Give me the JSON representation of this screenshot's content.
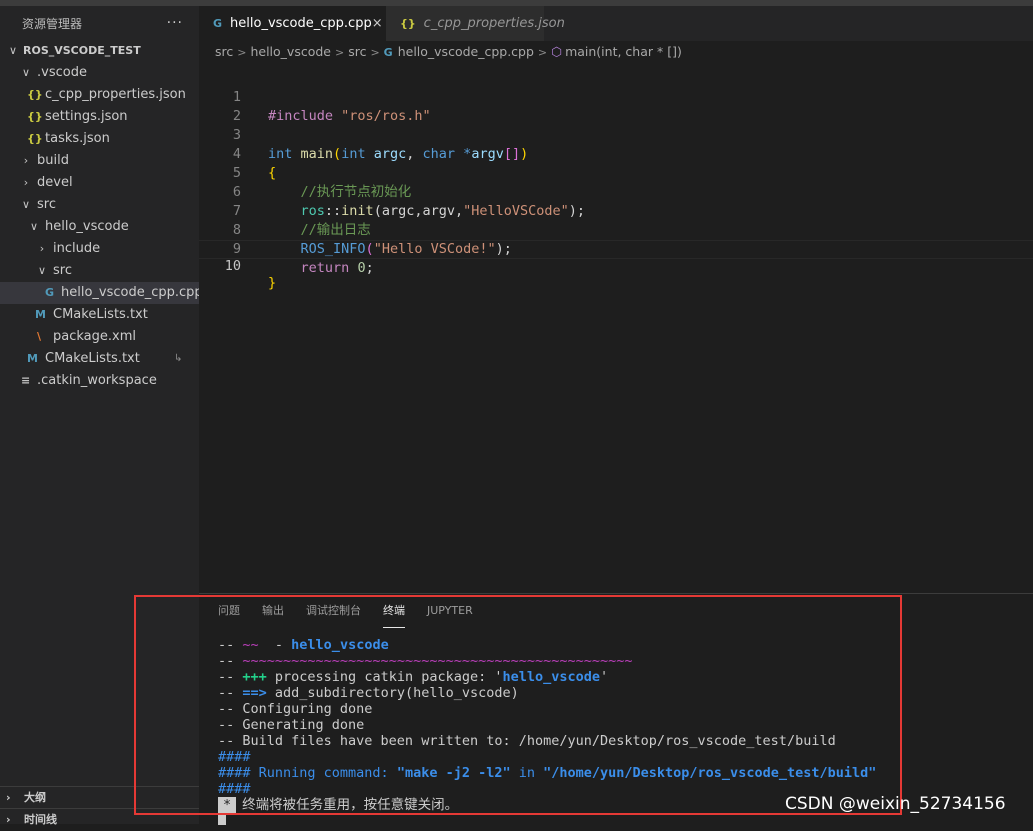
{
  "explorer": {
    "title": "资源管理器",
    "more": "···",
    "root": "ROS_VSCODE_TEST",
    "items": [
      {
        "label": ".vscode",
        "chev": "∨",
        "indent": 1
      },
      {
        "label": "c_cpp_properties.json",
        "icon": "{}",
        "indent": 2
      },
      {
        "label": "settings.json",
        "icon": "{}",
        "indent": 2
      },
      {
        "label": "tasks.json",
        "icon": "{}",
        "indent": 2
      },
      {
        "label": "build",
        "chev": "›",
        "indent": 1
      },
      {
        "label": "devel",
        "chev": "›",
        "indent": 1
      },
      {
        "label": "src",
        "chev": "∨",
        "indent": 1
      },
      {
        "label": "hello_vscode",
        "chev": "∨",
        "indent": 2
      },
      {
        "label": "include",
        "chev": "›",
        "indent": 3
      },
      {
        "label": "src",
        "chev": "∨",
        "indent": 3
      },
      {
        "label": "hello_vscode_cpp.cpp",
        "icon": "G",
        "indent": 4
      },
      {
        "label": "CMakeLists.txt",
        "icon": "M",
        "indent": 3
      },
      {
        "label": "package.xml",
        "icon": "\\",
        "indent": 3
      },
      {
        "label": "CMakeLists.txt",
        "icon": "M",
        "indent": 2,
        "badge": "↳"
      },
      {
        "label": ".catkin_workspace",
        "icon": "≡",
        "indent": 1
      }
    ],
    "outline": "大纲",
    "timeline": "时间线"
  },
  "tabs": [
    {
      "label": "hello_vscode_cpp.cpp",
      "icon": "G",
      "close": "×"
    },
    {
      "label": "c_cpp_properties.json",
      "icon": "{}"
    }
  ],
  "breadcrumbs": {
    "b1": "src",
    "b2": "hello_vscode",
    "b3": "src",
    "b4": "hello_vscode_cpp.cpp",
    "b5": "main(int, char * [])",
    "sep": ">"
  },
  "code": {
    "lines": [
      "1",
      "2",
      "3",
      "4",
      "5",
      "6",
      "7",
      "8",
      "9",
      "10"
    ],
    "l1_inc": "#include",
    "l1_str": "\"ros/ros.h\"",
    "l3_int": "int",
    "l3_main": "main",
    "l3_p1": "(",
    "l3_int2": "int",
    "l3_argc": "argc",
    "l3_comma": ",",
    "l3_char": "char",
    "l3_star": "*",
    "l3_argv": "argv",
    "l3_br": "[]",
    "l3_p2": ")",
    "l4_brace": "{",
    "l5_cm": "//执行节点初始化",
    "l6_ns": "ros",
    "l6_sc": "::",
    "l6_init": "init",
    "l6_args": "(argc,argv,",
    "l6_str": "\"HelloVSCode\"",
    "l6_end": ");",
    "l7_cm": "//输出日志",
    "l8_mac": "ROS_INFO",
    "l8_p": "(",
    "l8_str": "\"Hello VSCode!\"",
    "l8_end": ");",
    "l9_ret": "return",
    "l9_num": "0",
    "l9_end": ";",
    "l10_brace": "}"
  },
  "panel": {
    "tabs": [
      "问题",
      "输出",
      "调试控制台",
      "终端",
      "JUPYTER"
    ],
    "active_tab": "终端"
  },
  "terminal": {
    "t1_a": "-- ",
    "t1_b": "~~",
    "t1_c": "  - ",
    "t1_d": "hello_vscode",
    "t2_a": "-- ",
    "t2_b": "~~~~~~~~~~~~~~~~~~~~~~~~~~~~~~~~~~~~~~~~~~~~~~~~",
    "t3_a": "-- ",
    "t3_b": "+++",
    "t3_c": " processing catkin package: '",
    "t3_d": "hello_vscode",
    "t3_e": "'",
    "t4_a": "-- ",
    "t4_b": "==>",
    "t4_c": " add_subdirectory(hello_vscode)",
    "t5": "-- Configuring done",
    "t6": "-- Generating done",
    "t7": "-- Build files have been written to: /home/yun/Desktop/ros_vscode_test/build",
    "t8": "####",
    "t9_a": "#### Running command: ",
    "t9_b": "\"make -j2 -l2\"",
    "t9_c": " in ",
    "t9_d": "\"/home/yun/Desktop/ros_vscode_test/build\"",
    "t10": "####",
    "t11_badge": "*",
    "t11_msg": "终端将被任务重用，按任意键关闭。"
  },
  "watermark": "CSDN @weixin_52734156",
  "colors": {
    "highlight_box": "#e53935",
    "json_icon": "#cbcb41",
    "cpp_icon": "#519aba",
    "xml_icon": "#e37933"
  }
}
